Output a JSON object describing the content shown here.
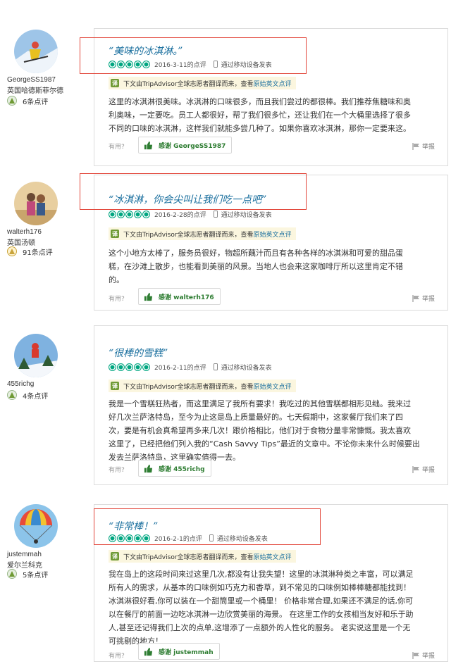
{
  "reviews": [
    {
      "user": {
        "name": "GeorgeSS1987",
        "location": "英国哈德斯菲尔德",
        "review_count": "6条点评"
      },
      "title": "“美味的冰淇淋。”",
      "rating": 5,
      "date": "2016-3-11的点评",
      "mobile": "通过移动设备发表",
      "translation_note": "下文由TripAdvisor全球志愿者翻译而来，查看",
      "original_link": "原始英文点评",
      "body_lines": [
        "这里的冰淇淋很美味。冰淇淋的口味很多，而且我们尝过的都很棒。我们推荐焦糖味和奥",
        "利奥味，一定要吃。员工人都很好，帮了我们很多忙，还让我们在一个大桶里选择了很多",
        "不同的口味的冰淇淋，这样我们就能多尝几种了。如果你喜欢冰淇淋，那你一定要来这。"
      ],
      "useful_label": "有用?",
      "thanks_label": "感谢 GeorgeSS1987",
      "report_label": "举报"
    },
    {
      "user": {
        "name": "walterh176",
        "location": "英国汤顿",
        "review_count": "91条点评"
      },
      "title": "“冰淇淋，你会尖叫让我们吃一点吧”",
      "rating": 5,
      "date": "2016-2-28的点评",
      "mobile": "通过移动设备发表",
      "translation_note": "下文由TripAdvisor全球志愿者翻译而来，查看",
      "original_link": "原始英文点评",
      "body_lines": [
        "这个小地方太棒了，服务员很好，物超所藕汁而且有各种各样的冰淇淋和可爱的甜品蛋",
        "糕，在沙滩上散步，也能看到美丽的风景。当地人也会来这家咖啡厅所以这里肯定不错",
        "的。"
      ],
      "useful_label": "有用?",
      "thanks_label": "感谢 walterh176",
      "report_label": "举报"
    },
    {
      "user": {
        "name": "455richg",
        "location": "",
        "review_count": "4条点评"
      },
      "title": "“很棒的雪糕”",
      "rating": 5,
      "date": "2016-2-11的点评",
      "mobile": "通过移动设备发表",
      "translation_note": "下文由TripAdvisor全球志愿者翻译而来，查看",
      "original_link": "原始英文点评",
      "body_lines": [
        "我是一个雪糕狂热者，而这里满足了我所有要求！我吃过的其他雪糕都相形见绌。我来过",
        "好几次兰萨洛特岛，至今为止这是岛上质量最好的。七天假期中，这家餐厅我们来了四",
        "次，要是有机会真希望再多来几次！跟价格相比，他们对于食物分量非常慷慨。我太喜欢",
        "这里了，已经把他们列入我的“Cash Savvy Tips”最近的文章中。不论你未来什么时候要出",
        "发去兰萨洛特岛，这里确实值得一去。"
      ],
      "useful_label": "有用?",
      "thanks_label": "感谢 455richg",
      "report_label": "举报"
    },
    {
      "user": {
        "name": "justemmah",
        "location": "爱尔兰科克",
        "review_count": "5条点评"
      },
      "title": "“非常棒！”",
      "rating": 5,
      "date": "2016-2-1的点评",
      "mobile": "通过移动设备发表",
      "translation_note": "下文由TripAdvisor全球志愿者翻译而来，查看",
      "original_link": "原始英文点评",
      "body_lines": [
        "我在岛上的这段时间来过这里几次,都没有让我失望！这里的冰淇淋种类之丰富，可以满足",
        "所有人的需求，从基本的口味例如巧克力和香草，到不常见的口味例如棒棒糖都能找到！",
        "冰淇淋很好看,你可以装在一个甜筒里或一个桶里！ 价格非常合理,如果还不满足的话,你可",
        "以在餐厅的前面一边吃冰淇淋一边欣赏美丽的海景。 在这里工作的女孩相当友好和乐于助",
        "人,甚至还记得我们上次的点单,这增添了一点额外的人性化的服务。 老实说这里是一个无",
        "可挑剔的地方！"
      ],
      "useful_label": "有用?",
      "thanks_label": "感谢 justemmah",
      "report_label": "举报"
    }
  ],
  "colors": {
    "accent": "#00a680",
    "title": "#1a6f9e",
    "highlight": "#e2463a",
    "thanks": "#2e7d32"
  }
}
